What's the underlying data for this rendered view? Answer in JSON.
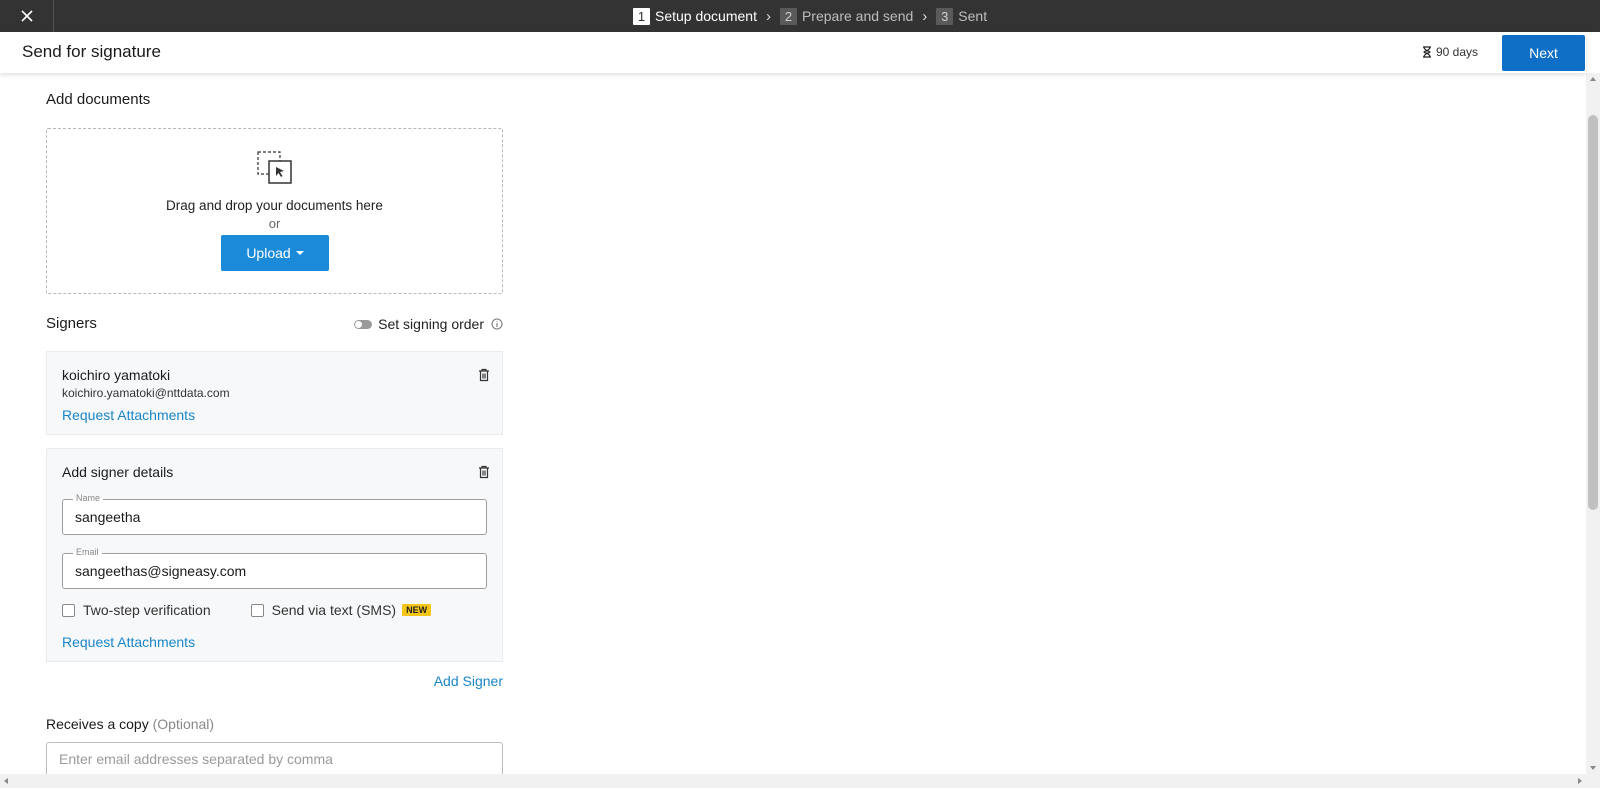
{
  "steps": [
    {
      "num": "1",
      "label": "Setup document"
    },
    {
      "num": "2",
      "label": "Prepare and send"
    },
    {
      "num": "3",
      "label": "Sent"
    }
  ],
  "header": {
    "title": "Send for signature",
    "expiry": "90 days",
    "next_label": "Next"
  },
  "documents": {
    "title": "Add documents",
    "drop_text": "Drag and drop your documents here",
    "or_text": "or",
    "upload_label": "Upload"
  },
  "signers": {
    "title": "Signers",
    "signing_order_label": "Set signing order",
    "list": [
      {
        "name": "koichiro yamatoki",
        "email": "koichiro.yamatoki@nttdata.com",
        "request_attachments": "Request Attachments"
      }
    ],
    "new_signer": {
      "title": "Add signer details",
      "name_label": "Name",
      "name_value": "sangeetha",
      "email_label": "Email",
      "email_value": "sangeethas@signeasy.com",
      "two_step_label": "Two-step verification",
      "sms_label": "Send via text (SMS)",
      "new_badge": "NEW",
      "request_attachments": "Request Attachments"
    },
    "add_signer_label": "Add Signer"
  },
  "copy": {
    "title": "Receives a copy",
    "optional": "(Optional)",
    "placeholder": "Enter email addresses separated by comma"
  }
}
